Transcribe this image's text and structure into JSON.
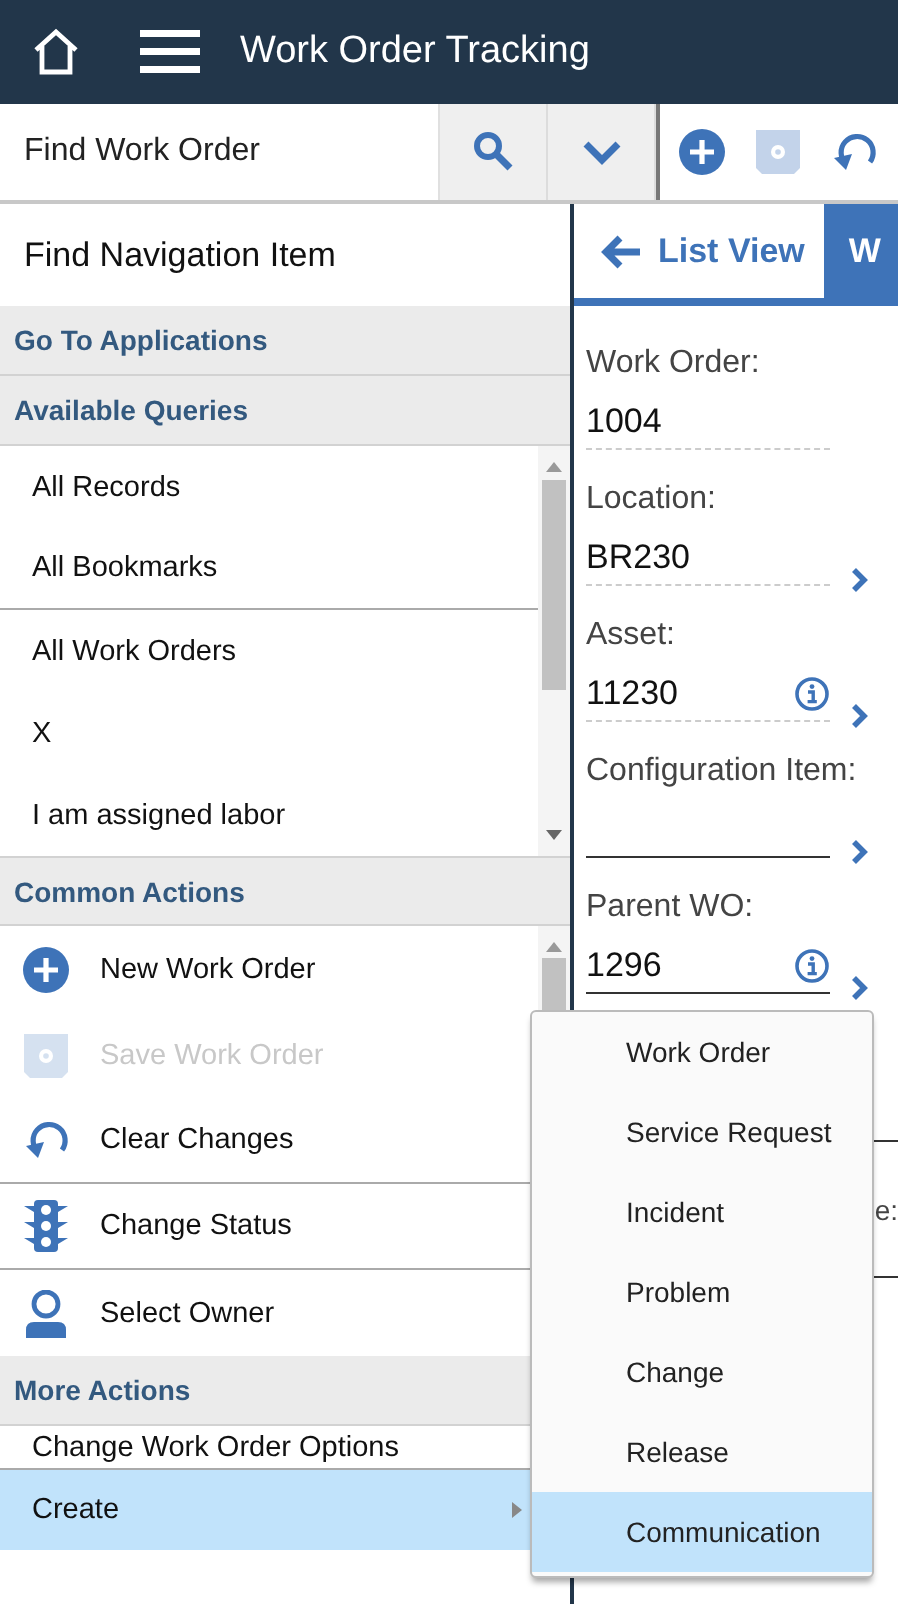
{
  "app": {
    "title": "Work Order Tracking"
  },
  "toolbar": {
    "search": {
      "placeholder": "Find Work Order"
    },
    "actions": [
      {
        "kind": "add",
        "disabled": false
      },
      {
        "kind": "save",
        "disabled": true
      },
      {
        "kind": "undo",
        "disabled": false
      }
    ]
  },
  "navigation": {
    "search": {
      "placeholder": "Find Navigation Item"
    },
    "go_to_applications": {
      "title": "Go To Applications"
    },
    "available_queries": {
      "title": "Available Queries",
      "items": [
        {
          "label": "All Records",
          "separator_after": false
        },
        {
          "label": "All Bookmarks",
          "separator_after": true
        },
        {
          "label": "All Work Orders",
          "separator_after": false
        },
        {
          "label": "X",
          "separator_after": false
        },
        {
          "label": "I am assigned labor",
          "separator_after": false
        }
      ]
    },
    "common_actions": {
      "title": "Common Actions",
      "items": [
        {
          "label": "New Work Order",
          "kind": "add",
          "disabled": false,
          "separator_after": false
        },
        {
          "label": "Save Work Order",
          "kind": "save",
          "disabled": true,
          "separator_after": false
        },
        {
          "label": "Clear Changes",
          "kind": "undo",
          "disabled": false,
          "separator_after": true
        },
        {
          "label": "Change Status",
          "kind": "status",
          "disabled": false,
          "separator_after": true
        },
        {
          "label": "Select Owner",
          "kind": "owner",
          "disabled": false,
          "separator_after": false
        }
      ]
    },
    "more_actions": {
      "title": "More Actions",
      "items": [
        {
          "label": "Change Work Order Options",
          "selected": false,
          "has_submenu": false
        },
        {
          "label": "Create",
          "selected": true,
          "has_submenu": true
        }
      ]
    }
  },
  "detail": {
    "tabs": [
      {
        "label": "List View",
        "kind": "back",
        "selected": false
      },
      {
        "label": "W",
        "kind": "tab",
        "selected": true
      }
    ],
    "fields": [
      {
        "label": "Work Order:",
        "value": "1004",
        "editable": false,
        "info": false,
        "link": false
      },
      {
        "label": "Location:",
        "value": "BR230",
        "editable": false,
        "info": false,
        "link": true
      },
      {
        "label": "Asset:",
        "value": "11230",
        "editable": false,
        "info": true,
        "link": true
      },
      {
        "label": "Configuration Item:",
        "editable": true,
        "info": false,
        "link": true
      },
      {
        "label": "Parent WO:",
        "value": "1296",
        "editable": true,
        "info": true,
        "link": true
      }
    ],
    "covered_label": "e:"
  },
  "submenu": {
    "items": [
      {
        "label": "Work Order",
        "selected": false
      },
      {
        "label": "Service Request",
        "selected": false
      },
      {
        "label": "Incident",
        "selected": false
      },
      {
        "label": "Problem",
        "selected": false
      },
      {
        "label": "Change",
        "selected": false
      },
      {
        "label": "Release",
        "selected": false
      },
      {
        "label": "Communication",
        "selected": true
      }
    ]
  }
}
